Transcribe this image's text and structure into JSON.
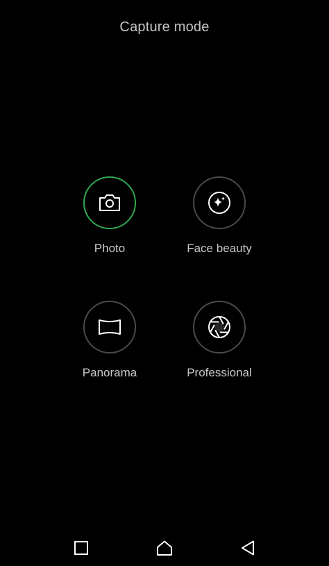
{
  "header": {
    "title": "Capture mode"
  },
  "modes": [
    {
      "label": "Photo",
      "icon": "camera-icon",
      "selected": true
    },
    {
      "label": "Face beauty",
      "icon": "sparkle-icon",
      "selected": false
    },
    {
      "label": "Panorama",
      "icon": "panorama-icon",
      "selected": false
    },
    {
      "label": "Professional",
      "icon": "aperture-icon",
      "selected": false
    }
  ],
  "navigation": {
    "recent_icon": "square-icon",
    "home_icon": "home-icon",
    "back_icon": "triangle-back-icon"
  },
  "colors": {
    "background": "#000000",
    "selected_ring": "#2fa84f",
    "ring": "#4a4a4a",
    "text": "#c8c8c8"
  }
}
